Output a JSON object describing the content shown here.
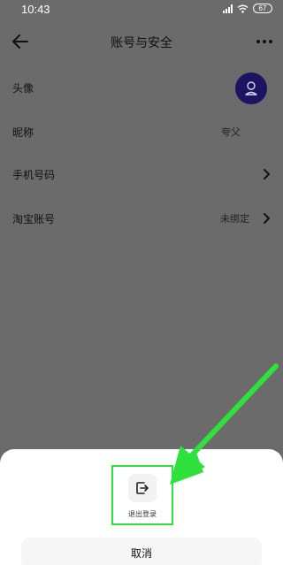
{
  "status_bar": {
    "time": "10:43",
    "battery": "67"
  },
  "header": {
    "title": "账号与安全"
  },
  "rows": [
    {
      "label": "头像"
    },
    {
      "label": "昵称",
      "value": "夸父"
    },
    {
      "label": "手机号码"
    },
    {
      "label": "淘宝账号",
      "value": "未绑定"
    }
  ],
  "sheet": {
    "logout_label": "退出登录",
    "cancel_label": "取消"
  },
  "colors": {
    "overlay": "#6b6b6b",
    "avatar": "#1c1460",
    "highlight_green": "#2fe23b",
    "sheet_bg": "#ffffff"
  },
  "icons": [
    "back-arrow-icon",
    "more-icon",
    "chevron-right-icon",
    "avatar-icon",
    "logout-icon",
    "wifi-icon",
    "signal-icon",
    "battery-icon"
  ]
}
